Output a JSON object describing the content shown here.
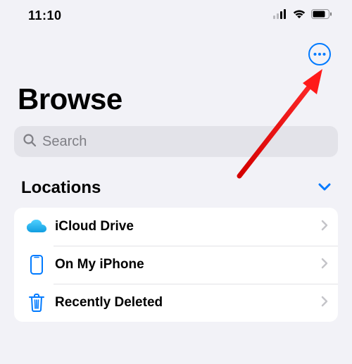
{
  "status": {
    "time": "11:10"
  },
  "header": {
    "title": "Browse"
  },
  "search": {
    "placeholder": "Search"
  },
  "section": {
    "title": "Locations"
  },
  "rows": [
    {
      "label": "iCloud Drive"
    },
    {
      "label": "On My iPhone"
    },
    {
      "label": "Recently Deleted"
    }
  ],
  "colors": {
    "accent": "#007aff"
  }
}
